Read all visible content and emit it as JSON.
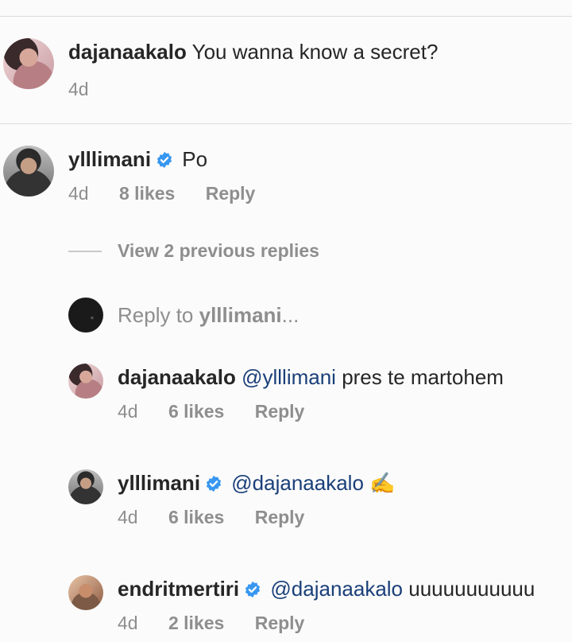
{
  "comments": [
    {
      "username": "dajanaakalo",
      "text": "You wanna know a secret?",
      "age": "4d",
      "verified": false
    },
    {
      "username": "ylllimani",
      "text": "Po",
      "age": "4d",
      "likes": "8 likes",
      "reply": "Reply",
      "verified": true
    }
  ],
  "thread": {
    "view_replies": "View 2 previous replies",
    "reply_prefix": "Reply to ",
    "reply_user": "ylllimani",
    "reply_suffix": "..."
  },
  "replies": [
    {
      "username": "dajanaakalo",
      "mention": "@ylllimani",
      "text": "pres te martohem",
      "age": "4d",
      "likes": "6 likes",
      "reply": "Reply",
      "verified": false
    },
    {
      "username": "ylllimani",
      "mention": "@dajanaakalo",
      "text": "✍️",
      "age": "4d",
      "likes": "6 likes",
      "reply": "Reply",
      "verified": true
    },
    {
      "username": "endritmertiri",
      "mention": "@dajanaakalo",
      "text": "uuuuuuuuuuu",
      "age": "4d",
      "likes": "2 likes",
      "reply": "Reply",
      "verified": true
    }
  ],
  "colors": {
    "verified_badge": "#3897f0",
    "mention": "#1a3f79",
    "meta_text": "#8e8e8e"
  }
}
